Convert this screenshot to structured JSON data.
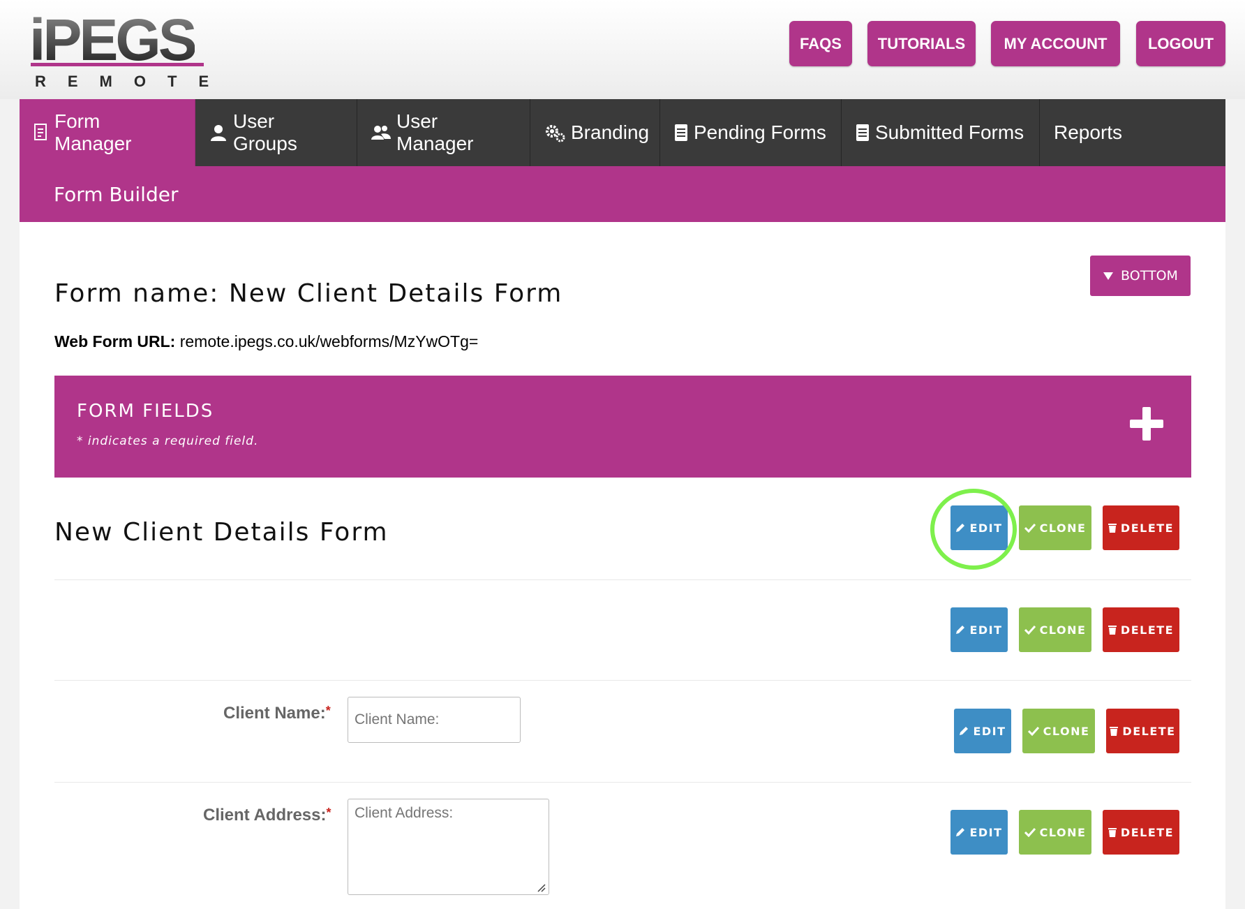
{
  "brand": {
    "name": "iPEGS",
    "sub": "REMOTE"
  },
  "header_buttons": [
    "FAQS",
    "TUTORIALS",
    "MY ACCOUNT",
    "LOGOUT"
  ],
  "nav": {
    "items": [
      {
        "label": "Form Manager",
        "icon": "form-icon",
        "active": true
      },
      {
        "label": "User Groups",
        "icon": "user-icon"
      },
      {
        "label": "User Manager",
        "icon": "users-icon"
      },
      {
        "label": "Branding",
        "icon": "gears-icon"
      },
      {
        "label": "Pending Forms",
        "icon": "document-icon"
      },
      {
        "label": "Submitted Forms",
        "icon": "document-icon"
      },
      {
        "label": "Reports",
        "icon": ""
      }
    ],
    "sub_item": "Form Builder"
  },
  "page": {
    "bottom_label": "BOTTOM",
    "form_name_prefix": "Form name:",
    "form_name": "New Client Details Form",
    "web_url_label": "Web Form URL:",
    "web_url": "remote.ipegs.co.uk/webforms/MzYwOTg="
  },
  "fields_panel": {
    "title": "FORM FIELDS",
    "note": "* indicates a required field."
  },
  "section_title": "New Client Details Form",
  "actions": {
    "edit": "EDIT",
    "clone": "CLONE",
    "delete": "DELETE"
  },
  "fields": [
    {
      "label": "Client Name:",
      "required": "*",
      "placeholder": "Client Name:"
    },
    {
      "label": "Client Address:",
      "required": "*",
      "placeholder": "Client Address:"
    }
  ],
  "colors": {
    "brand": "#b0358a",
    "nav_dark": "#3a3a3a",
    "edit": "#3e8ec5",
    "clone": "#8dc04e",
    "delete": "#c8241e",
    "highlight": "#7ef04c"
  }
}
